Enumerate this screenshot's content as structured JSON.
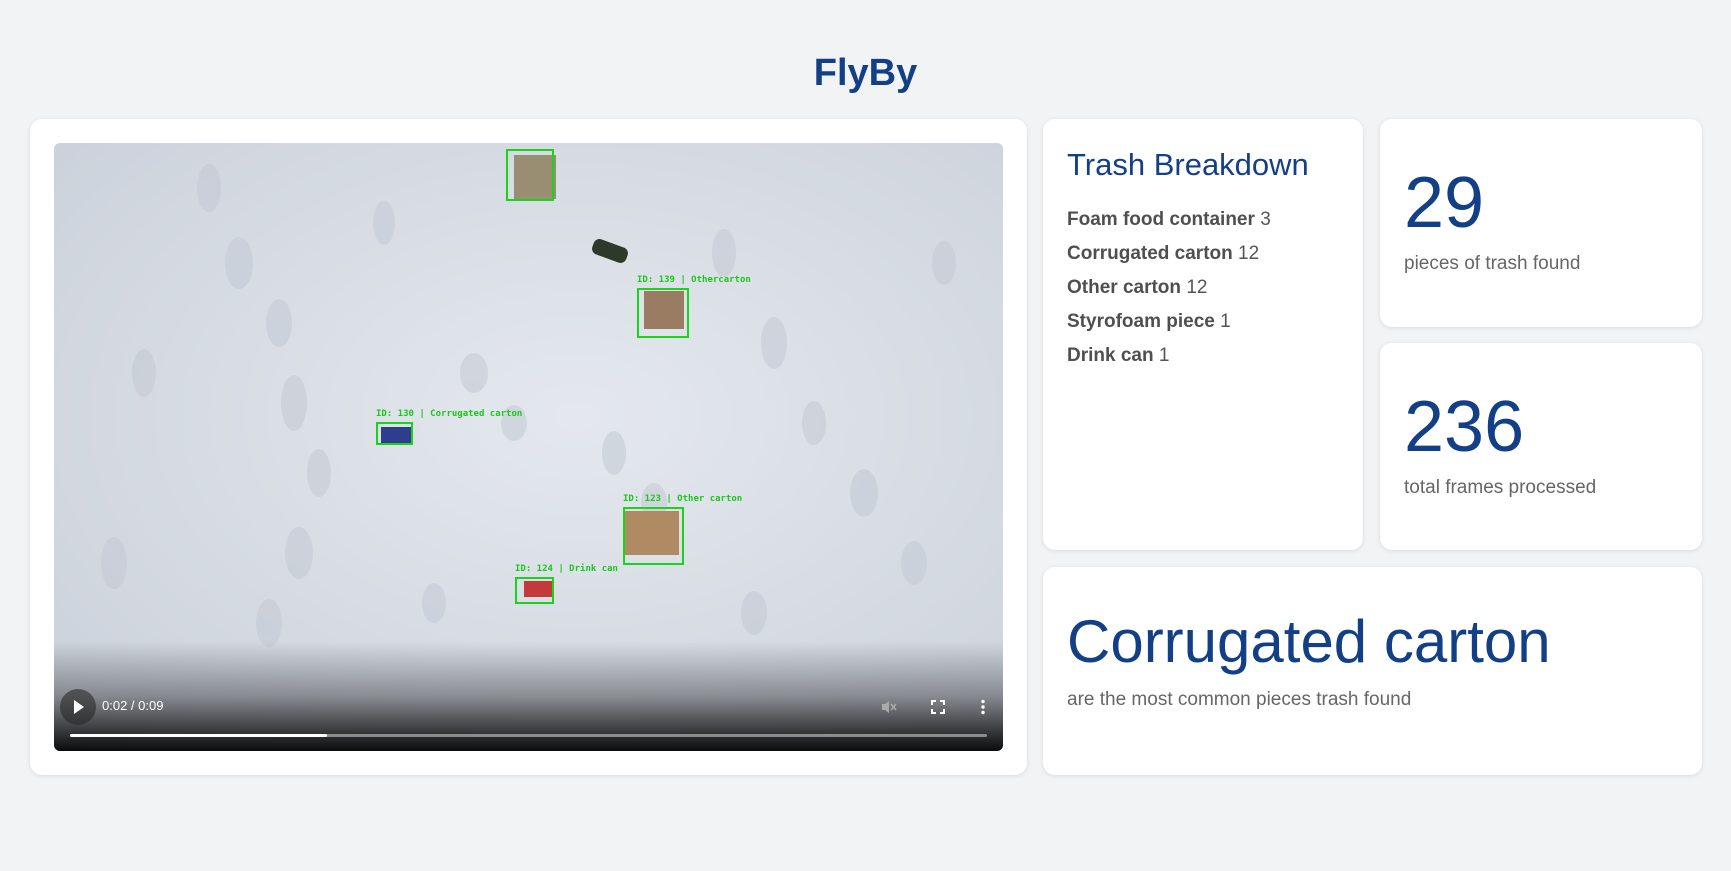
{
  "app": {
    "title": "FlyBy"
  },
  "video": {
    "time": "0:02 / 0:09",
    "progress_fraction": 0.28,
    "detections": [
      {
        "label": "ID: 130 | Corrugated carton"
      },
      {
        "label": "ID: 139 | Othercarton"
      },
      {
        "label": "ID: 123 | Other carton"
      },
      {
        "label": "ID: 124 | Drink can"
      }
    ]
  },
  "breakdown": {
    "title": "Trash Breakdown",
    "items": [
      {
        "name": "Foam food container",
        "count": "3"
      },
      {
        "name": "Corrugated carton",
        "count": "12"
      },
      {
        "name": "Other carton",
        "count": "12"
      },
      {
        "name": "Styrofoam piece",
        "count": "1"
      },
      {
        "name": "Drink can",
        "count": "1"
      }
    ]
  },
  "stats": {
    "trash_count": "29",
    "trash_caption": "pieces of trash found",
    "frames": "236",
    "frames_caption": "total frames processed"
  },
  "common": {
    "value": "Corrugated carton",
    "caption": "are the most common pieces trash found"
  },
  "colors": {
    "accent": "#123f86",
    "detection": "#19d419",
    "background": "#f2f3f5"
  },
  "icons": [
    "play-icon",
    "mute-icon",
    "fullscreen-icon",
    "more-options-icon"
  ]
}
